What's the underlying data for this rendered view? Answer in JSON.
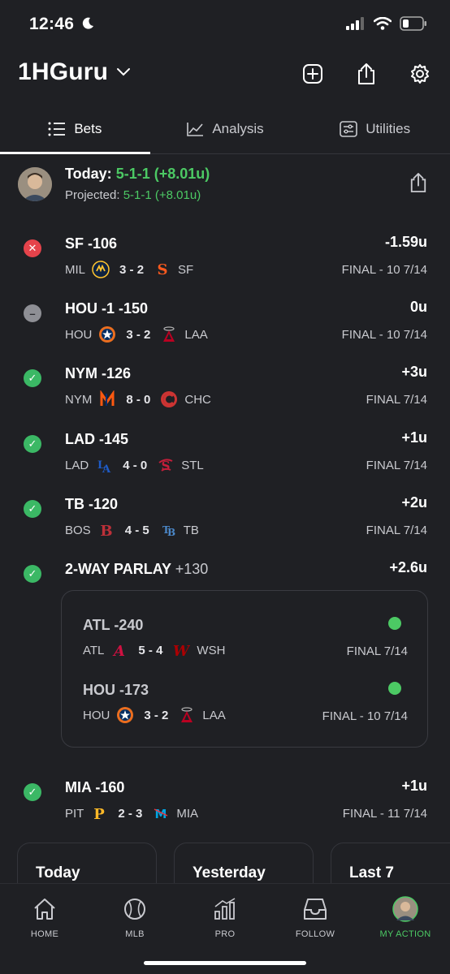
{
  "status_bar": {
    "time": "12:46"
  },
  "header": {
    "title": "1HGuru"
  },
  "tabs": [
    {
      "label": "Bets",
      "active": true
    },
    {
      "label": "Analysis",
      "active": false
    },
    {
      "label": "Utilities",
      "active": false
    }
  ],
  "summary": {
    "today_label": "Today:",
    "today_value": "5-1-1 (+8.01u)",
    "projected_label": "Projected:",
    "projected_value": "5-1-1 (+8.01u)"
  },
  "bets": [
    {
      "status": "loss",
      "status_glyph": "✕",
      "team": "SF",
      "odds": "-106",
      "result": "-1.59u",
      "away": "MIL",
      "score": "3 - 2",
      "home": "SF",
      "final": "FINAL - 10 7/14"
    },
    {
      "status": "push",
      "status_glyph": "–",
      "team": "HOU -1",
      "odds": "-150",
      "result": "0u",
      "away": "HOU",
      "score": "3 - 2",
      "home": "LAA",
      "final": "FINAL - 10 7/14"
    },
    {
      "status": "win",
      "status_glyph": "✓",
      "team": "NYM",
      "odds": "-126",
      "result": "+3u",
      "away": "NYM",
      "score": "8 - 0",
      "home": "CHC",
      "final": "FINAL 7/14"
    },
    {
      "status": "win",
      "status_glyph": "✓",
      "team": "LAD",
      "odds": "-145",
      "result": "+1u",
      "away": "LAD",
      "score": "4 - 0",
      "home": "STL",
      "final": "FINAL 7/14"
    },
    {
      "status": "win",
      "status_glyph": "✓",
      "team": "TB",
      "odds": "-120",
      "result": "+2u",
      "away": "BOS",
      "score": "4 - 5",
      "home": "TB",
      "final": "FINAL 7/14"
    }
  ],
  "parlay": {
    "status_glyph": "✓",
    "label": "2-WAY PARLAY",
    "odds": "+130",
    "result": "+2.6u",
    "legs": [
      {
        "team": "ATL",
        "odds": "-240",
        "away": "ATL",
        "score": "5 - 4",
        "home": "WSH",
        "final": "FINAL 7/14"
      },
      {
        "team": "HOU",
        "odds": "-173",
        "away": "HOU",
        "score": "3 - 2",
        "home": "LAA",
        "final": "FINAL - 10 7/14"
      }
    ]
  },
  "last_bet": {
    "status_glyph": "✓",
    "team": "MIA",
    "odds": "-160",
    "result": "+1u",
    "away": "PIT",
    "score": "2 - 3",
    "home": "MIA",
    "final": "FINAL - 11 7/14"
  },
  "cards": [
    "Today",
    "Yesterday",
    "Last 7"
  ],
  "bottom_nav": [
    {
      "label": "HOME",
      "icon": "home-icon"
    },
    {
      "label": "MLB",
      "icon": "baseball-icon"
    },
    {
      "label": "PRO",
      "icon": "chart-icon"
    },
    {
      "label": "FOLLOW",
      "icon": "inbox-icon"
    },
    {
      "label": "MY ACTION",
      "icon": "avatar-icon",
      "active": true
    }
  ],
  "colors": {
    "background": "#1f2024",
    "win": "#4cc964",
    "loss": "#e5434b",
    "push": "#8e8f95"
  }
}
